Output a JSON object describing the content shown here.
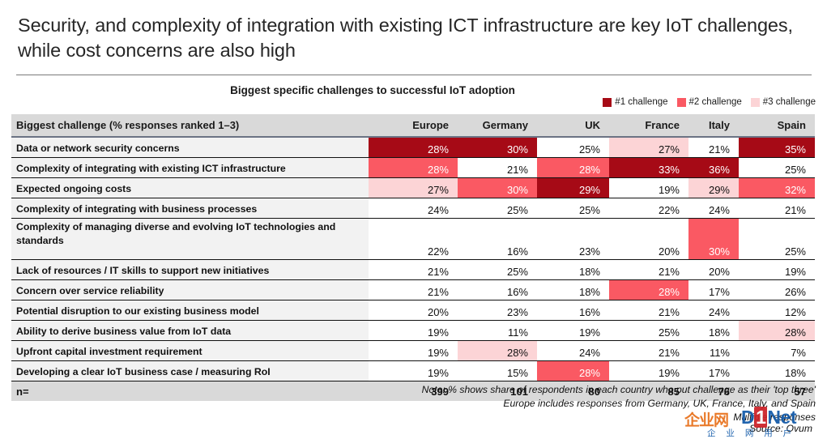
{
  "title": "Security, and complexity of integration with existing ICT infrastructure are key IoT challenges, while cost concerns are also high",
  "subtitle": "Biggest specific challenges to successful IoT adoption",
  "legend": [
    {
      "label": "#1 challenge",
      "color": "#a60a16"
    },
    {
      "label": "#2 challenge",
      "color": "#fa5963"
    },
    {
      "label": "#3 challenge",
      "color": "#fcd4d6"
    }
  ],
  "colors": {
    "rank1": "#a60a16",
    "rank2": "#fa5963",
    "rank3": "#fcd4d6",
    "none": "#ffffff",
    "header_bg": "#d9d9d9",
    "label_bg": "#f2f2f2"
  },
  "table": {
    "row_header": "Biggest challenge (% responses ranked 1–3)",
    "columns": [
      "Europe",
      "Germany",
      "UK",
      "France",
      "Italy",
      "Spain"
    ],
    "n_label": "n=",
    "n_values": [
      "399",
      "101",
      "80",
      "85",
      "76",
      "57"
    ],
    "rows": [
      {
        "label": "Data or network security concerns",
        "values": [
          "28%",
          "30%",
          "25%",
          "27%",
          "21%",
          "35%"
        ],
        "ranks": [
          1,
          1,
          0,
          3,
          0,
          1
        ]
      },
      {
        "label": "Complexity of integrating with existing ICT infrastructure",
        "values": [
          "28%",
          "21%",
          "28%",
          "33%",
          "36%",
          "25%"
        ],
        "ranks": [
          2,
          0,
          2,
          1,
          1,
          0
        ]
      },
      {
        "label": "Expected ongoing costs",
        "values": [
          "27%",
          "30%",
          "29%",
          "19%",
          "29%",
          "32%"
        ],
        "ranks": [
          3,
          2,
          1,
          0,
          3,
          2
        ]
      },
      {
        "label": "Complexity of integrating with business processes",
        "values": [
          "24%",
          "25%",
          "25%",
          "22%",
          "24%",
          "21%"
        ],
        "ranks": [
          0,
          0,
          0,
          0,
          0,
          0
        ]
      },
      {
        "label": "Complexity of managing diverse and evolving IoT technologies and standards",
        "values": [
          "22%",
          "16%",
          "23%",
          "20%",
          "30%",
          "25%"
        ],
        "ranks": [
          0,
          0,
          0,
          0,
          2,
          0
        ],
        "tall": true
      },
      {
        "label": "Lack of resources / IT skills to support new initiatives",
        "values": [
          "21%",
          "25%",
          "18%",
          "21%",
          "20%",
          "19%"
        ],
        "ranks": [
          0,
          0,
          0,
          0,
          0,
          0
        ]
      },
      {
        "label": "Concern over service reliability",
        "values": [
          "21%",
          "16%",
          "18%",
          "28%",
          "17%",
          "26%"
        ],
        "ranks": [
          0,
          0,
          0,
          2,
          0,
          0
        ]
      },
      {
        "label": "Potential disruption to our existing business model",
        "values": [
          "20%",
          "23%",
          "16%",
          "21%",
          "24%",
          "12%"
        ],
        "ranks": [
          0,
          0,
          0,
          0,
          0,
          0
        ]
      },
      {
        "label": "Ability to derive business value from IoT data",
        "values": [
          "19%",
          "11%",
          "19%",
          "25%",
          "18%",
          "28%"
        ],
        "ranks": [
          0,
          0,
          0,
          0,
          0,
          3
        ]
      },
      {
        "label": "Upfront capital investment requirement",
        "values": [
          "19%",
          "28%",
          "24%",
          "21%",
          "11%",
          "7%"
        ],
        "ranks": [
          0,
          3,
          0,
          0,
          0,
          0
        ]
      },
      {
        "label": "Developing a clear IoT business case / measuring RoI",
        "values": [
          "19%",
          "15%",
          "28%",
          "19%",
          "17%",
          "18%"
        ],
        "ranks": [
          0,
          0,
          2,
          0,
          0,
          0
        ]
      }
    ]
  },
  "notes": [
    "Note: % shows share of respondents in each country who put challenge as their 'top three'",
    "Europe includes responses from Germany, UK, France, Italy, and Spain",
    "Multiple responses"
  ],
  "source": "Source: Ovum",
  "watermark": {
    "cn": "企业网",
    "d": "D",
    "one": "1",
    "net": "Net",
    "sub": "企 业 网 用 户"
  }
}
